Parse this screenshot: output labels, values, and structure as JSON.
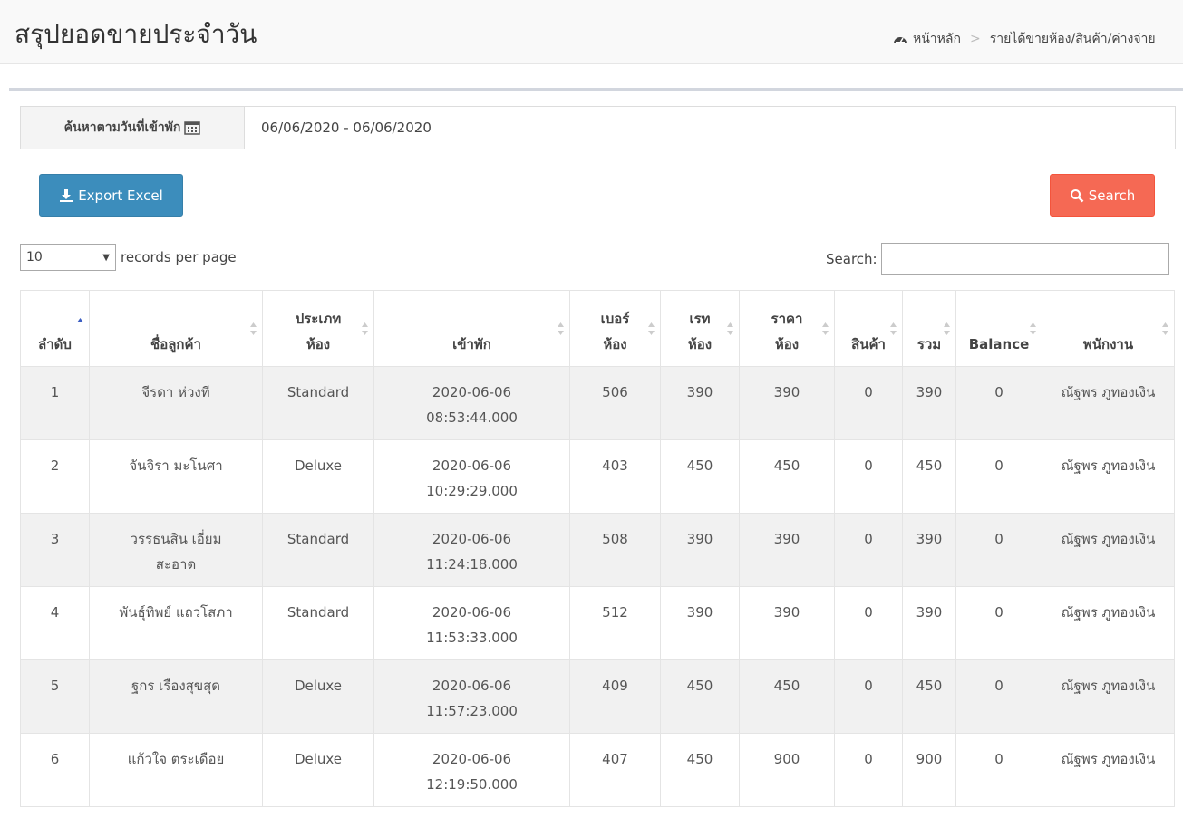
{
  "header": {
    "title": "สรุปยอดขายประจำวัน",
    "breadcrumb": [
      "หน้าหลัก",
      "รายได้ขายห้อง/สินค้า/ค่างจ่าย"
    ]
  },
  "filter": {
    "label": "ค้นหาตามวันที่เข้าพัก",
    "date_range": "06/06/2020 - 06/06/2020"
  },
  "buttons": {
    "export": "Export Excel",
    "search": "Search"
  },
  "table_controls": {
    "page_length": "10",
    "page_length_label": "records per page",
    "search_label": "Search:"
  },
  "table": {
    "columns": [
      "ลำดับ",
      "ชื่อลูกค้า",
      "ประเภทห้อง",
      "เข้าพัก",
      "เบอร์ห้อง",
      "เรทห้อง",
      "ราคาห้อง",
      "สินค้า",
      "รวม",
      "Balance",
      "พนักงาน"
    ],
    "rows": [
      {
        "no": "1",
        "customer": "จีรดา ห่วงที",
        "room_type": "Standard",
        "check_in": "2020-06-06 08:53:44.000",
        "room_no": "506",
        "rate": "390",
        "price": "390",
        "product": "0",
        "total": "390",
        "balance": "0",
        "staff": "ณัฐพร ภูทองเงิน"
      },
      {
        "no": "2",
        "customer": "จันจิรา มะโนศา",
        "room_type": "Deluxe",
        "check_in": "2020-06-06 10:29:29.000",
        "room_no": "403",
        "rate": "450",
        "price": "450",
        "product": "0",
        "total": "450",
        "balance": "0",
        "staff": "ณัฐพร ภูทองเงิน"
      },
      {
        "no": "3",
        "customer": "วรรธนสิน เอี่ยมสะอาด",
        "room_type": "Standard",
        "check_in": "2020-06-06 11:24:18.000",
        "room_no": "508",
        "rate": "390",
        "price": "390",
        "product": "0",
        "total": "390",
        "balance": "0",
        "staff": "ณัฐพร ภูทองเงิน"
      },
      {
        "no": "4",
        "customer": "พันธุ์ทิพย์ แถวโสภา",
        "room_type": "Standard",
        "check_in": "2020-06-06 11:53:33.000",
        "room_no": "512",
        "rate": "390",
        "price": "390",
        "product": "0",
        "total": "390",
        "balance": "0",
        "staff": "ณัฐพร ภูทองเงิน"
      },
      {
        "no": "5",
        "customer": "ฐกร เรืองสุขสุด",
        "room_type": "Deluxe",
        "check_in": "2020-06-06 11:57:23.000",
        "room_no": "409",
        "rate": "450",
        "price": "450",
        "product": "0",
        "total": "450",
        "balance": "0",
        "staff": "ณัฐพร ภูทองเงิน"
      },
      {
        "no": "6",
        "customer": "แก้วใจ ตระเดือย",
        "room_type": "Deluxe",
        "check_in": "2020-06-06 12:19:50.000",
        "room_no": "407",
        "rate": "450",
        "price": "900",
        "product": "0",
        "total": "900",
        "balance": "0",
        "staff": "ณัฐพร ภูทองเงิน"
      }
    ]
  },
  "colors": {
    "export_button": "#3c8dbc",
    "search_button": "#f56954",
    "rate": "#c9302c",
    "price": "#2e7d32",
    "total": "#8e24aa",
    "balance": "#9e9d24"
  },
  "icons": {
    "breadcrumb_home": "dashboard-icon",
    "date_label": "calendar-icon",
    "export": "download-icon",
    "search": "search-icon",
    "settings": "gear-icon"
  }
}
